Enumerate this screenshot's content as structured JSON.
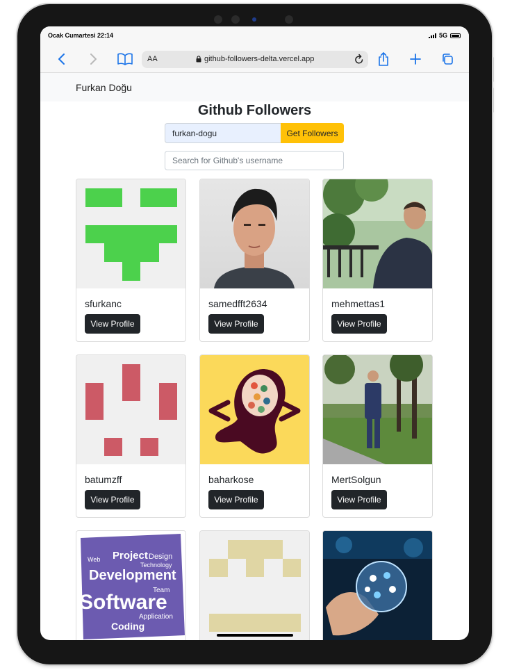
{
  "status": {
    "time": "Ocak Cumartesi 22:14",
    "network": "5G"
  },
  "browser": {
    "aa_label": "AA",
    "url": "github-followers-delta.vercel.app"
  },
  "navbar": {
    "brand": "Furkan Doğu"
  },
  "page": {
    "title": "Github Followers",
    "username_value": "furkan-dogu",
    "get_button": "Get Followers",
    "search_placeholder": "Search for Github's username"
  },
  "followers": [
    {
      "login": "sfurkanc",
      "button": "View Profile"
    },
    {
      "login": "samedfft2634",
      "button": "View Profile"
    },
    {
      "login": "mehmettas1",
      "button": "View Profile"
    },
    {
      "login": "batumzff",
      "button": "View Profile"
    },
    {
      "login": "baharkose",
      "button": "View Profile"
    },
    {
      "login": "MertSolgun",
      "button": "View Profile"
    },
    {
      "login": "",
      "button": ""
    },
    {
      "login": "",
      "button": ""
    },
    {
      "login": "",
      "button": ""
    }
  ],
  "avatar_texts": {
    "wordcloud": [
      "Project",
      "Design",
      "Development",
      "Software",
      "Coding",
      "Application",
      "Web",
      "Technology",
      "Team"
    ]
  },
  "colors": {
    "accent_yellow": "#ffc107",
    "button_dark": "#212529",
    "identicon_green": "#4cd14c",
    "identicon_red": "#cc5a66",
    "identicon_beige": "#e0d6a4"
  }
}
